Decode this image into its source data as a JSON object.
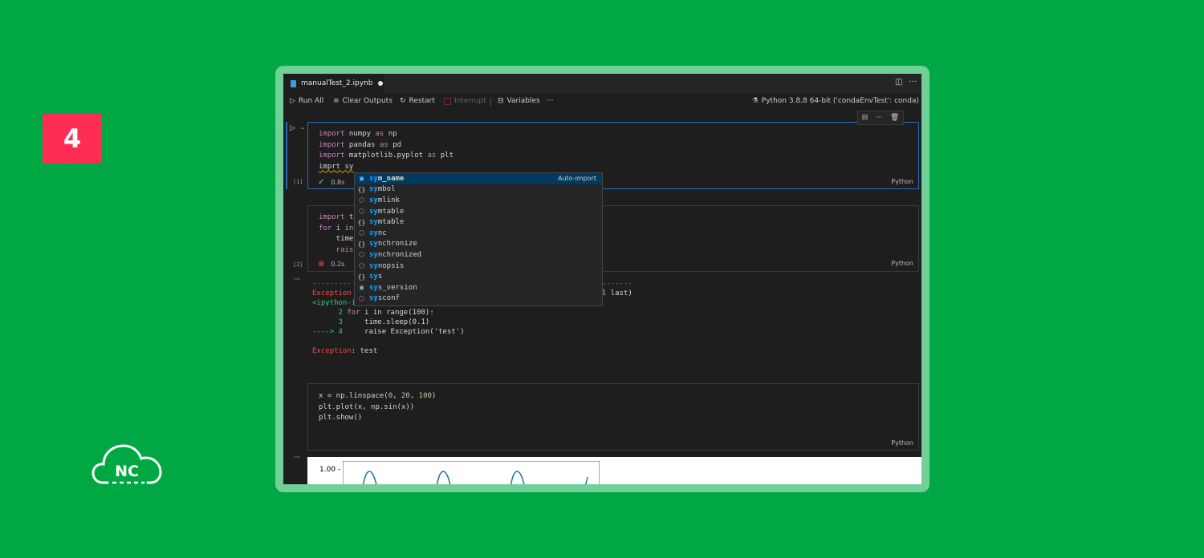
{
  "step_badge": "4",
  "logo": {
    "text": "NC"
  },
  "tab": {
    "filename": "manualTest_2.ipynb"
  },
  "toolbar": {
    "run_all": "Run All",
    "clear_outputs": "Clear Outputs",
    "restart": "Restart",
    "interrupt": "Interrupt",
    "variables": "Variables",
    "more": "···",
    "kernel": "Python 3.8.8 64-bit ('condaEnvTest': conda)"
  },
  "cells": [
    {
      "count": "[1]",
      "lines": [
        "import numpy as np",
        "import pandas as pd",
        "import matplotlib.pyplot as plt",
        "imprt sy"
      ],
      "time": "0.8s",
      "lang": "Python"
    },
    {
      "count": "[2]",
      "lines": [
        "import t",
        "for i in",
        "    time",
        "    rais"
      ],
      "time": "0.2s",
      "lang": "Python"
    },
    {
      "lines": [
        "x = np.linspace(0, 20, 100)",
        "plt.plot(x, np.sin(x))",
        "plt.show()"
      ],
      "lang": "Python"
    }
  ],
  "output": {
    "dashes_left": "---------",
    "dashes_right": "---------",
    "exception_head": "Exception",
    "call_last": "all last)",
    "ipython": "<ipython-i",
    "tb_line2_no": "      2",
    "tb_line2_code": " i in range(100):",
    "tb_line3_no": "      3",
    "tb_line3_code": "     time.sleep(0.1)",
    "tb_arrow": "----> 4",
    "tb_line4_code": "     raise Exception('test')",
    "exception_label": "Exception",
    "exception_msg": ": test"
  },
  "suggestions": [
    {
      "icon": "var",
      "match": "sy",
      "rest": "m_name",
      "detail": "Auto-import"
    },
    {
      "icon": "brace",
      "match": "sy",
      "rest": "mbol"
    },
    {
      "icon": "mod",
      "match": "sy",
      "rest": "mlink"
    },
    {
      "icon": "mod",
      "match": "sy",
      "rest": "mtable"
    },
    {
      "icon": "brace",
      "match": "sy",
      "rest": "mtable"
    },
    {
      "icon": "mod",
      "match": "sy",
      "rest": "nc"
    },
    {
      "icon": "brace",
      "match": "sy",
      "rest": "nchronize"
    },
    {
      "icon": "mod",
      "match": "sy",
      "rest": "nchronized"
    },
    {
      "icon": "mod",
      "match": "sy",
      "rest": "nopsis"
    },
    {
      "icon": "brace",
      "match": "sy",
      "rest": "s"
    },
    {
      "icon": "var",
      "match": "sy",
      "rest": "s_version"
    },
    {
      "icon": "mod",
      "match": "sy",
      "rest": "sconf"
    }
  ],
  "plot": {
    "ytick": "1.00 -"
  },
  "colors": {
    "background": "#00a843",
    "frame": "#71cf98",
    "badge": "#ff2d55",
    "editor": "#1e1e1e"
  }
}
